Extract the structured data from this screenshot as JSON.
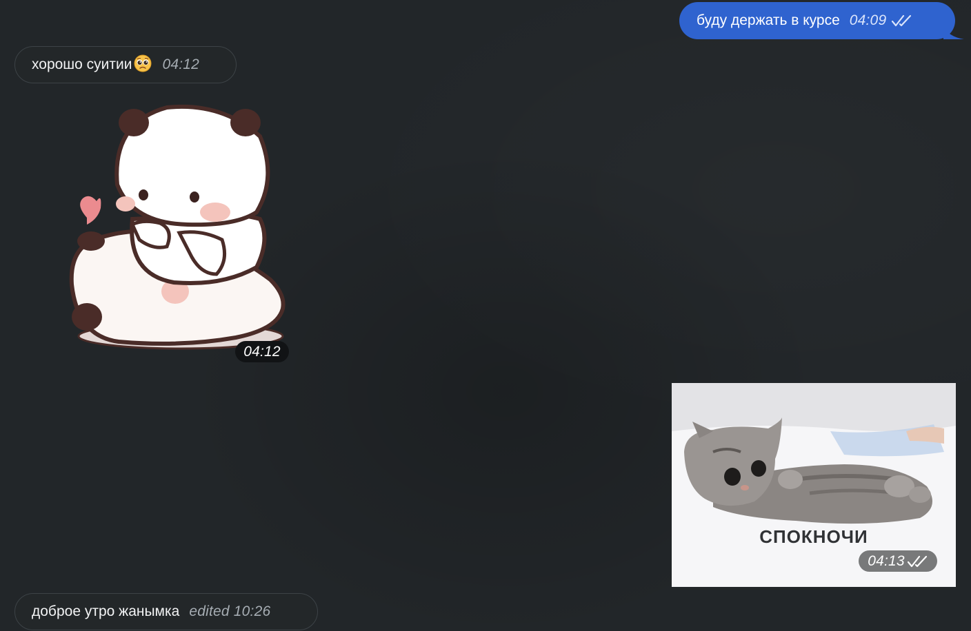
{
  "messages": {
    "out_1": {
      "text": "буду держать в курсе",
      "time": "04:09",
      "status_icon": "double-check-icon"
    },
    "in_1": {
      "text": "хорошо суитии",
      "emoji": "pleading-face-emoji",
      "time": "04:12"
    },
    "sticker_1": {
      "kind": "sticker",
      "subject": "two-panda-bears-hug-sticker",
      "time": "04:12"
    },
    "media_out_1": {
      "kind": "gif",
      "caption": "СПОКНОЧИ",
      "time": "04:13",
      "status_icon": "double-check-icon"
    },
    "in_2": {
      "text": "доброе утро жанымка",
      "edited_label": "edited",
      "time": "10:26"
    }
  },
  "colors": {
    "background": "#222629",
    "outgoing_bubble": "#2f63cf",
    "incoming_bubble_border": "#3d4347"
  }
}
